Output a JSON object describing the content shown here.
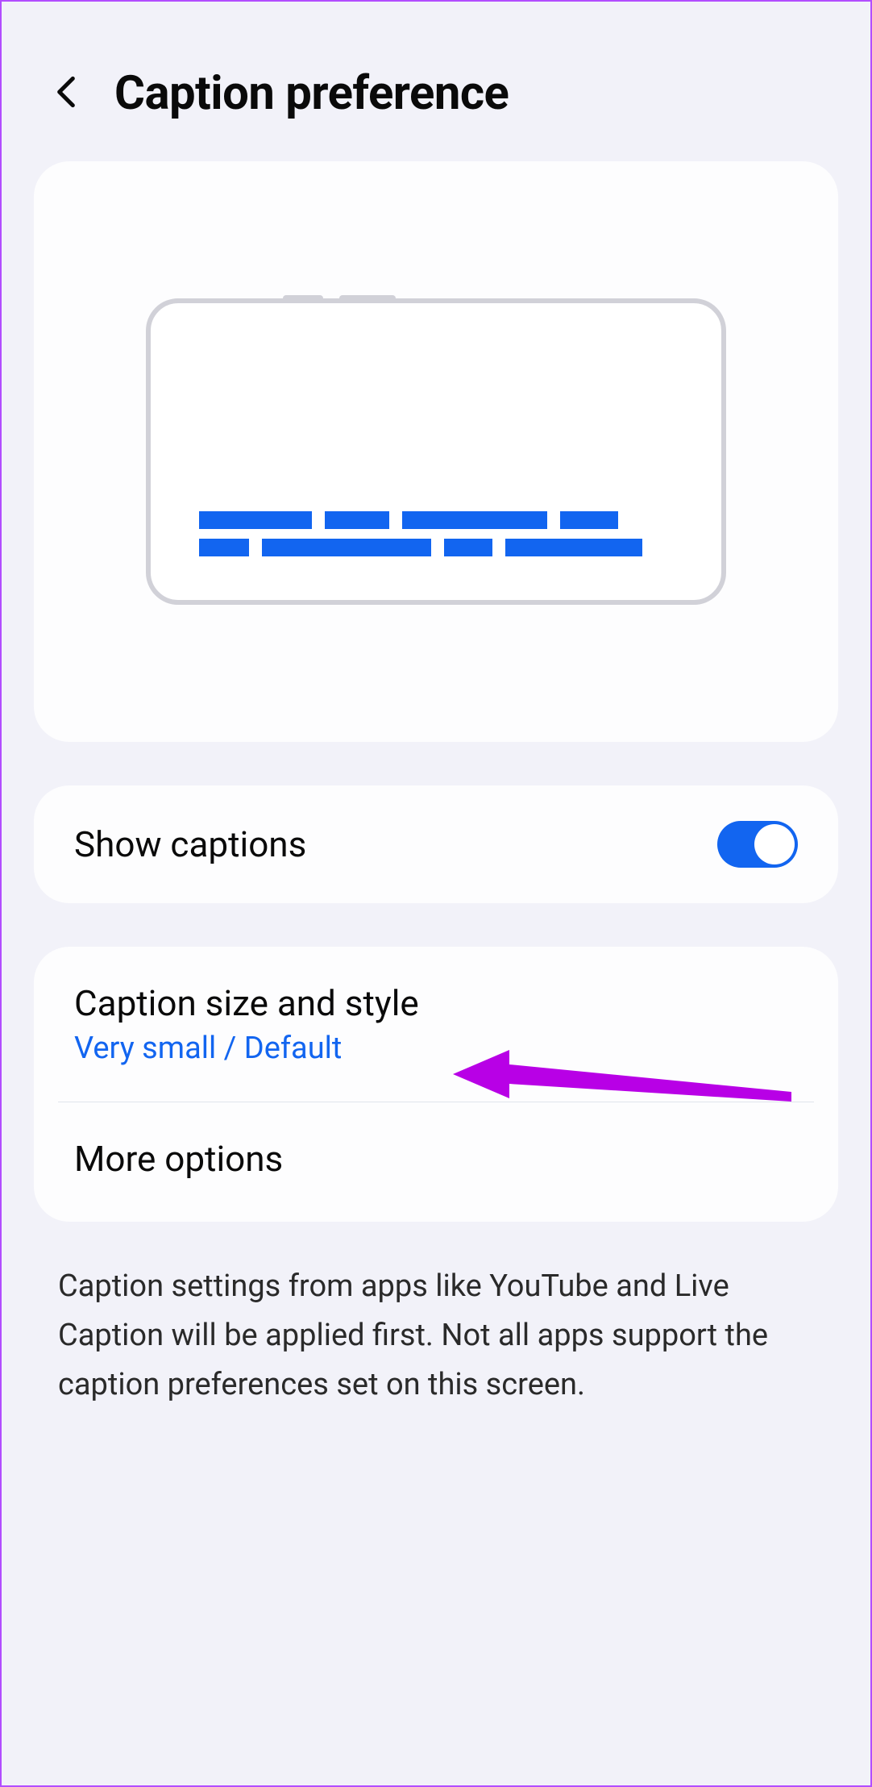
{
  "header": {
    "title": "Caption preference"
  },
  "toggle": {
    "label": "Show captions",
    "state": true
  },
  "list": {
    "caption_style": {
      "primary": "Caption size and style",
      "secondary": "Very small / Default"
    },
    "more_options": {
      "primary": "More options"
    }
  },
  "info": "Caption settings from apps like YouTube and Live Caption will be applied first. Not all apps support the caption preferences set on this screen."
}
